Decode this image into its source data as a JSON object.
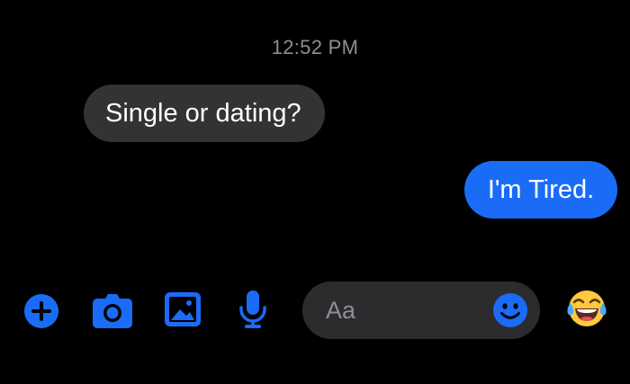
{
  "conversation": {
    "timestamp": "12:52 PM",
    "messages": [
      {
        "direction": "incoming",
        "text": "Single or dating?"
      },
      {
        "direction": "outgoing",
        "text": "I'm Tired."
      }
    ]
  },
  "composer": {
    "placeholder": "Aa",
    "actions": [
      "plus-icon",
      "camera-icon",
      "image-icon",
      "microphone-icon"
    ],
    "emoji_reaction": "😂"
  },
  "colors": {
    "accent": "#1a6cf7",
    "incoming_bubble": "#333333",
    "background": "#000000",
    "input_background": "#2c2c2e"
  }
}
